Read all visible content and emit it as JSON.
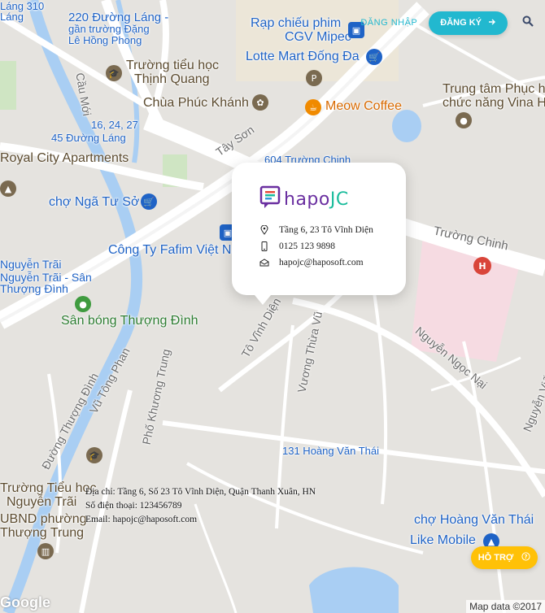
{
  "header": {
    "login_label": "ĐĂNG NHẬP",
    "register_label": "ĐĂNG KÝ",
    "accent": "#22b8cf"
  },
  "card": {
    "logo_part1": "hapo",
    "logo_part2": "JC",
    "address": "Tầng 6, 23 Tô Vĩnh Diện",
    "phone": "0125 123 9898",
    "email": "hapojc@haposoft.com",
    "icons": [
      "location-pin-icon",
      "phone-icon",
      "mail-icon"
    ]
  },
  "footer": {
    "address_line": "Địa chỉ: Tầng 6, Số 23 Tô Vĩnh Diện, Quận Thanh Xuân, HN",
    "phone_line": "Số điện thoại: 123456789",
    "email_line": "Email: hapojc@haposoft.com"
  },
  "support": {
    "label": "HỖ TRỢ",
    "color": "#ffc107"
  },
  "map": {
    "attribution": "Map data ©2017",
    "google": "Google",
    "labels": {
      "l1": "220 Đường Láng -",
      "l2": "gần trường Đặng",
      "l3": "Lê Hồng Phong",
      "l4": "Rạp chiếu phim",
      "l5": "CGV Mipec",
      "l6": "Lotte Mart Đống Đa",
      "l7": "Trường tiểu học",
      "l8": "Thịnh Quang",
      "l9": "Chùa Phúc Khánh",
      "l10": "Meow Coffee",
      "l11": "Trung tâm Phục hồi",
      "l12": "chức năng Vina H",
      "l13": "16, 24, 27",
      "l14": "45 Đường Láng",
      "l15": "Royal City Apartments",
      "l16": "chợ Ngã Tư Sở",
      "l17": "Công Ty Fafim Việt Nam",
      "l18": "Nguyễn Trãi",
      "l19": "Nguyễn Trãi - Sân",
      "l20": "Thượng Đình",
      "l21": "Sân bóng Thượng Đình",
      "l22": "Trường Chinh",
      "l23": "Nguyễn Ngọc Nại",
      "l24": "131 Hoàng Văn Thái",
      "l25": "Trường Tiểu học",
      "l26": "Nguyễn Trãi",
      "l27": "UBND phường",
      "l28": "Thượng Trung",
      "l29": "chợ Hoàng Văn Thái",
      "l30": "Like Mobile",
      "r1": "Tây Sơn",
      "r2": "604 Trường Chinh",
      "r3": "Cầu Mới",
      "r4": "Tô Vĩnh Diện",
      "r5": "Vương Thừa Vũ",
      "r6": "Vũ Tông Phan",
      "r7": "Phố Khương Trung",
      "r8": "Đường Thượng Đình",
      "r9": "Nguyễn Viết Xuân",
      "r10": "Láng",
      "r11": "Láng 310"
    }
  }
}
